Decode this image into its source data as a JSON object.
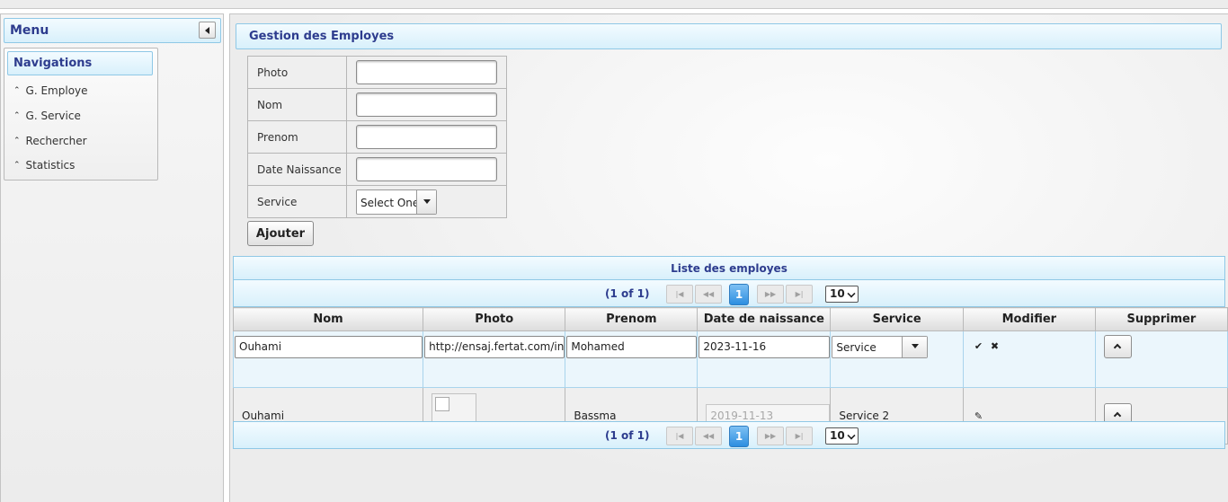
{
  "menu": {
    "title": "Menu"
  },
  "navigation": {
    "title": "Navigations",
    "items": [
      {
        "label": "G. Employe"
      },
      {
        "label": "G. Service"
      },
      {
        "label": "Rechercher"
      },
      {
        "label": "Statistics"
      }
    ]
  },
  "form": {
    "title": "Gestion des Employes",
    "fields": {
      "photo": {
        "label": "Photo",
        "value": ""
      },
      "nom": {
        "label": "Nom",
        "value": ""
      },
      "prenom": {
        "label": "Prenom",
        "value": ""
      },
      "date_naissance": {
        "label": "Date Naissance",
        "value": ""
      },
      "service": {
        "label": "Service",
        "selected": "Select One"
      }
    },
    "submit_label": "Ajouter"
  },
  "table": {
    "caption": "Liste des employes",
    "paginator": {
      "page_info": "(1 of 1)",
      "current_page": "1",
      "rows_per_page": "10"
    },
    "columns": [
      "Nom",
      "Photo",
      "Prenom",
      "Date de naissance",
      "Service",
      "Modifier",
      "Supprimer"
    ],
    "rows": [
      {
        "nom": "Ouhami",
        "photo": "http://ensaj.fertat.com/in",
        "prenom": "Mohamed",
        "date": "2023-11-16",
        "service": "Service",
        "mode": "edit"
      },
      {
        "nom": "Ouhami",
        "photo": "",
        "prenom": "Bassma",
        "date": "2019-11-13",
        "service": "Service 2",
        "mode": "view"
      }
    ]
  },
  "colors": {
    "header_text": "#2d3c8e",
    "header_bg": "#d8f0fb",
    "active_page": "#2d8ee0"
  }
}
